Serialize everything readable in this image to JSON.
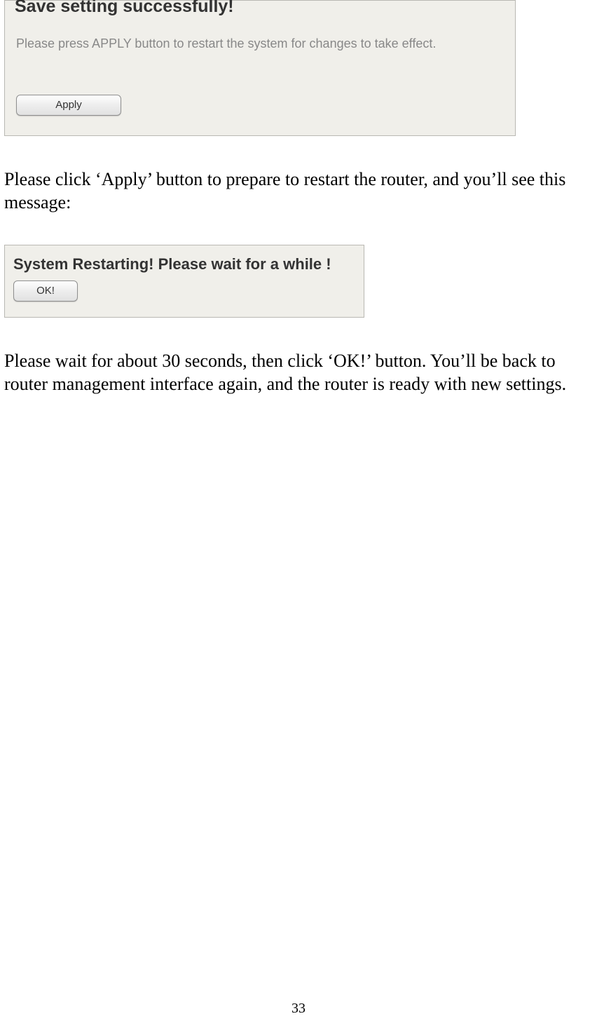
{
  "panel1": {
    "heading": "Save setting successfully!",
    "instruction": "Please press APPLY button to restart the system for changes to take effect.",
    "apply_label": "Apply"
  },
  "text1": "Please click ‘Apply’ button to prepare to restart the router, and you’ll see this message:",
  "panel2": {
    "heading": "System Restarting! Please wait for a while !",
    "ok_label": "OK!"
  },
  "text2": "Please wait for about 30 seconds, then click ‘OK!’ button. You’ll be back to router management interface again, and the router is ready with new settings.",
  "page_number": "33"
}
